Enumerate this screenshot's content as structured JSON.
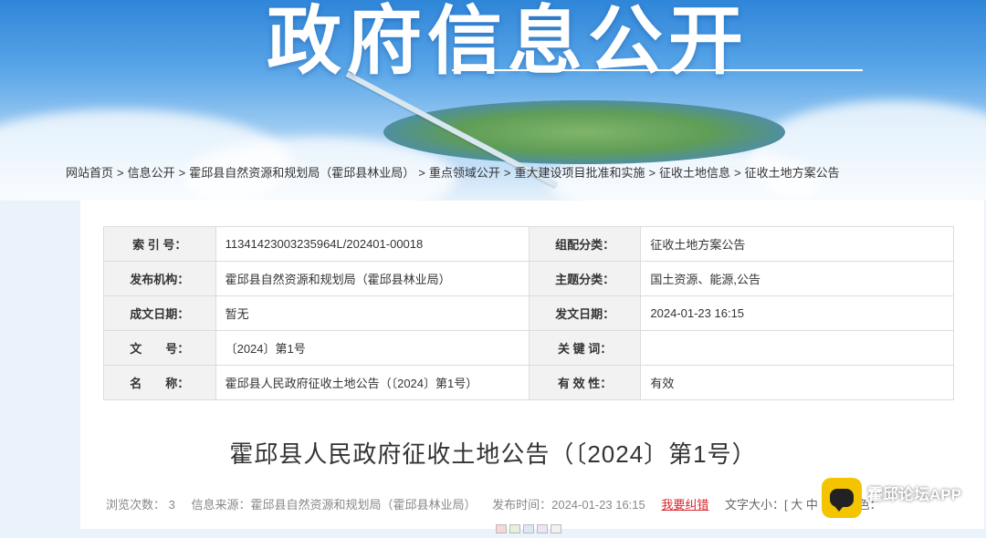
{
  "banner": {
    "title": "政府信息公开"
  },
  "breadcrumb": [
    "网站首页",
    "信息公开",
    "霍邱县自然资源和规划局（霍邱县林业局）",
    "重点领域公开",
    "重大建设项目批准和实施",
    "征收土地信息",
    "征收土地方案公告"
  ],
  "breadcrumb_sep": ">",
  "meta": {
    "rows": [
      {
        "l1": "索 引 号：",
        "v1": "11341423003235964L/202401-00018",
        "l2": "组配分类：",
        "v2": "征收土地方案公告"
      },
      {
        "l1": "发布机构：",
        "v1": "霍邱县自然资源和规划局（霍邱县林业局）",
        "l2": "主题分类：",
        "v2": "国土资源、能源,公告"
      },
      {
        "l1": "成文日期：",
        "v1": "暂无",
        "l2": "发文日期：",
        "v2": "2024-01-23 16:15"
      },
      {
        "l1": "文　　号：",
        "v1": "〔2024〕第1号",
        "l2": "关 键 词：",
        "v2": ""
      },
      {
        "l1": "名　　称：",
        "v1": "霍邱县人民政府征收土地公告（〔2024〕第1号）",
        "l2": "有 效 性：",
        "v2": "有效"
      }
    ]
  },
  "document": {
    "title": "霍邱县人民政府征收土地公告（〔2024〕第1号）"
  },
  "info": {
    "views": "浏览次数：  3",
    "source": "信息来源：霍邱县自然资源和规划局（霍邱县林业局）",
    "time": "发布时间：2024-01-23 16:15",
    "report": "我要纠错",
    "fontsize": "文字大小：[ 大  中",
    "bgcolor": "背景色："
  },
  "watermark": {
    "app_name": "霍邱论坛APP",
    "icon": "chat-bubble-icon"
  },
  "colors": {
    "accent_red": "#d9262c",
    "app_yellow": "#f5c400"
  }
}
